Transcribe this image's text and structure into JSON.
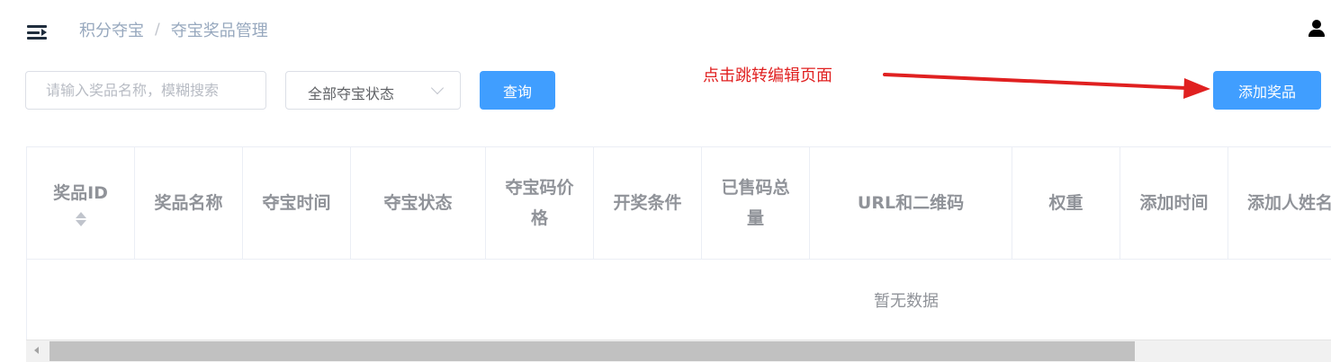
{
  "header": {
    "menu_icon": "menu-fold-icon",
    "breadcrumb": {
      "root": "积分夺宝",
      "separator": "/",
      "current": "夺宝奖品管理"
    },
    "user_icon": "user-icon"
  },
  "filters": {
    "search_placeholder": "请输入奖品名称，模糊搜索",
    "search_value": "",
    "status_select_value": "全部夺宝状态",
    "status_select_icon": "chevron-down-icon",
    "query_button": "查询",
    "add_button": "添加奖品"
  },
  "annotation": {
    "text": "点击跳转编辑页面",
    "color": "#e02020"
  },
  "table": {
    "columns": [
      {
        "label_lines": [
          "奖品ID"
        ],
        "sortable": true
      },
      {
        "label_lines": [
          "奖品名称"
        ]
      },
      {
        "label_lines": [
          "夺宝时间"
        ]
      },
      {
        "label_lines": [
          "夺宝状态"
        ]
      },
      {
        "label_lines": [
          "夺宝码价",
          "格"
        ]
      },
      {
        "label_lines": [
          "开奖条件"
        ]
      },
      {
        "label_lines": [
          "已售码总",
          "量"
        ]
      },
      {
        "label_lines": [
          "URL和二维码"
        ]
      },
      {
        "label_lines": [
          "权重"
        ]
      },
      {
        "label_lines": [
          "添加时间"
        ]
      },
      {
        "label_lines": [
          "添加人姓名"
        ]
      }
    ],
    "rows": [],
    "empty_text": "暂无数据"
  },
  "colors": {
    "primary": "#409eff",
    "header_text": "#909399",
    "annotation": "#e02020"
  }
}
